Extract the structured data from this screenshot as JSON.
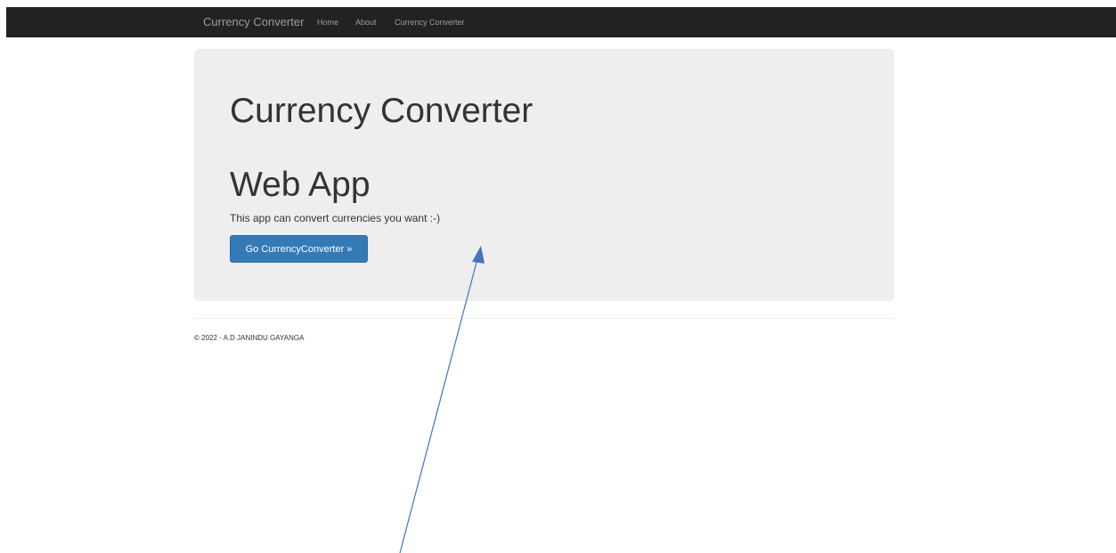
{
  "navbar": {
    "brand": "Currency Converter",
    "links": [
      "Home",
      "About",
      "Currency Converter"
    ]
  },
  "jumbotron": {
    "title_line1": "Currency Converter",
    "title_line2": "Web App",
    "lead": "This app can convert currencies you want :-)",
    "button_label": "Go CurrencyConverter »"
  },
  "footer": {
    "text": "© 2022 - A.D JANINDU GAYANGA"
  },
  "colors": {
    "navbar_bg": "#222222",
    "jumbotron_bg": "#eeeeee",
    "button_bg": "#337ab7",
    "annotation_arrow": "#4472c4"
  }
}
